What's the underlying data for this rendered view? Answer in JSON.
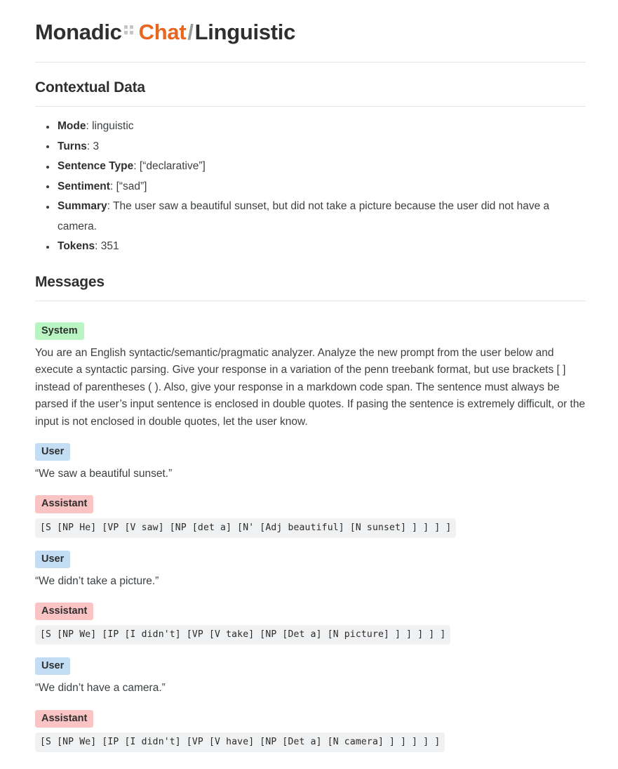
{
  "header": {
    "app_name": "Monadic",
    "separator_icon": "double-colon-dots-icon",
    "accent_word": "Chat",
    "slash": "/",
    "mode_name": "Linguistic",
    "accent_color": "#e8661f",
    "slash_color": "#9a9a9a",
    "dots_color": "#c3c5c7"
  },
  "contextual_data": {
    "title": "Contextual Data",
    "items": [
      {
        "key": "Mode",
        "value": "linguistic"
      },
      {
        "key": "Turns",
        "value": "3"
      },
      {
        "key": "Sentence Type",
        "value": "[“declarative”]"
      },
      {
        "key": "Sentiment",
        "value": "[“sad”]"
      },
      {
        "key": "Summary",
        "value": "The user saw a beautiful sunset, but did not take a picture because the user did not have a camera."
      },
      {
        "key": "Tokens",
        "value": "351"
      }
    ]
  },
  "messages_section": {
    "title": "Messages",
    "badge_colors": {
      "system": "#b9f5c2",
      "user": "#c3ddf5",
      "assistant": "#fac4c4"
    },
    "items": [
      {
        "role": "System",
        "role_class": "system",
        "type": "text",
        "text": "You are an English syntactic/semantic/pragmatic analyzer. Analyze the new prompt from the user below and execute a syntactic parsing. Give your response in a variation of the penn treebank format, but use brackets [ ] instead of parentheses ( ). Also, give your response in a markdown code span. The sentence must always be parsed if the user’s input sentence is enclosed in double quotes. If pasing the sentence is extremely difficult, or the input is not enclosed in double quotes, let the user know."
      },
      {
        "role": "User",
        "role_class": "user",
        "type": "text",
        "text": "“We saw a beautiful sunset.”"
      },
      {
        "role": "Assistant",
        "role_class": "assistant",
        "type": "code",
        "text": "[S [NP He] [VP [V saw] [NP [det a] [N' [Adj beautiful] [N sunset] ] ] ] ]"
      },
      {
        "role": "User",
        "role_class": "user",
        "type": "text",
        "text": "“We didn’t take a picture.”"
      },
      {
        "role": "Assistant",
        "role_class": "assistant",
        "type": "code",
        "text": "[S [NP We] [IP [I didn't] [VP [V take] [NP [Det a] [N picture] ] ] ] ] ]"
      },
      {
        "role": "User",
        "role_class": "user",
        "type": "text",
        "text": "“We didn’t have a camera.”"
      },
      {
        "role": "Assistant",
        "role_class": "assistant",
        "type": "code",
        "text": "[S [NP We] [IP [I didn't] [VP [V have] [NP [Det a] [N camera] ] ] ] ] ]"
      }
    ]
  }
}
